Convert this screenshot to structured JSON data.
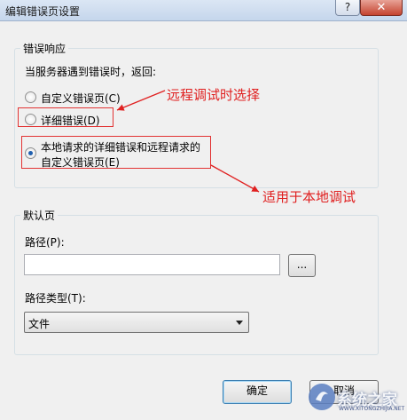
{
  "window": {
    "title": "编辑错误页设置",
    "help_label": "?",
    "close_label": "✕"
  },
  "error_response": {
    "legend": "错误响应",
    "prompt": "当服务器遇到错误时，返回:",
    "options": [
      {
        "label": "自定义错误页(C)",
        "checked": false
      },
      {
        "label": "详细错误(D)",
        "checked": false
      },
      {
        "label_line1": "本地请求的详细错误和远程请求的",
        "label_line2": "自定义错误页(E)",
        "checked": true
      }
    ]
  },
  "default_page": {
    "legend": "默认页",
    "path_label": "路径(P):",
    "path_value": "",
    "browse_label": "...",
    "path_type_label": "路径类型(T):",
    "path_type_value": "文件"
  },
  "footer": {
    "ok_label": "确定",
    "cancel_label": "取消"
  },
  "annotations": {
    "remote": "远程调试时选择",
    "local": "适用于本地调试",
    "color": "#e02020"
  },
  "watermark": {
    "text": "系统之家",
    "sub": "WWW.XITONGZHIJIA.NET"
  }
}
